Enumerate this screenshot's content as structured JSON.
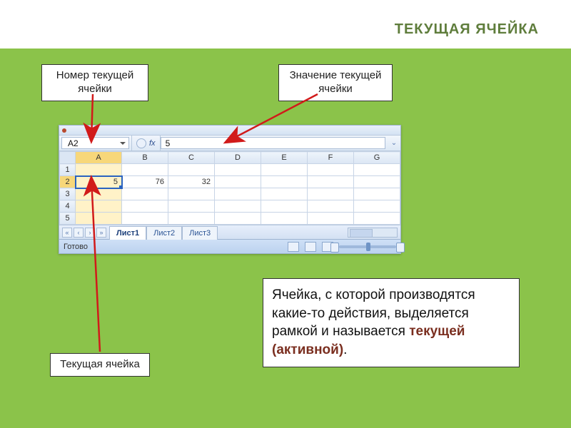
{
  "title": "ТЕКУЩАЯ ЯЧЕЙКА",
  "callouts": {
    "ref": "Номер текущей ячейки",
    "value": "Значение текущей ячейки",
    "active": "Текущая ячейка"
  },
  "definition": {
    "pre": "Ячейка, с которой производятся какие-то действия, выделяется рамкой и называется ",
    "em": "текущей (активной)",
    "post": "."
  },
  "excel": {
    "namebox": "A2",
    "fx_label": "fx",
    "formula_value": "5",
    "columns": [
      "A",
      "B",
      "C",
      "D",
      "E",
      "F",
      "G"
    ],
    "rows": [
      "1",
      "2",
      "3",
      "4",
      "5"
    ],
    "cells": {
      "A2": "5",
      "B2": "76",
      "C2": "32"
    },
    "selected": "A2",
    "tabs": [
      "Лист1",
      "Лист2",
      "Лист3"
    ],
    "active_tab": 0,
    "status": "Готово"
  },
  "colors": {
    "bg": "#8bc34a",
    "arrow": "#d11a1a",
    "emphasis": "#7a2e1f"
  }
}
